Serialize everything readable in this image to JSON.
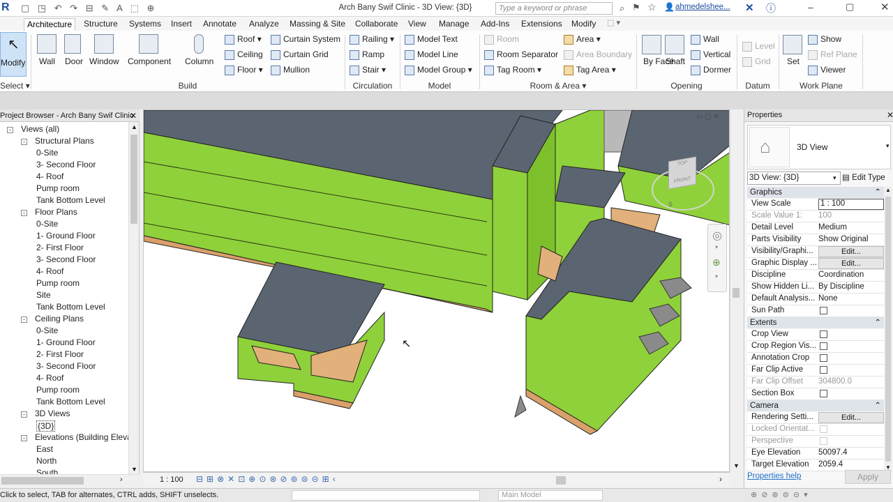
{
  "window": {
    "title": "Arch Bany Swif Clinic - 3D View: {3D}",
    "search_placeholder": "Type a keyword or phrase",
    "user": "ahmedelshee..."
  },
  "tabs": [
    "Architecture",
    "Structure",
    "Systems",
    "Insert",
    "Annotate",
    "Analyze",
    "Massing & Site",
    "Collaborate",
    "View",
    "Manage",
    "Add-Ins",
    "Extensions",
    "Modify"
  ],
  "ribbon": {
    "select": {
      "modify": "Modify",
      "select_label": "Select"
    },
    "build": {
      "label": "Build",
      "wall": "Wall",
      "door": "Door",
      "window": "Window",
      "component": "Component",
      "column": "Column",
      "roof": "Roof",
      "ceiling": "Ceiling",
      "floor": "Floor",
      "curtain_system": "Curtain System",
      "curtain_grid": "Curtain Grid",
      "mullion": "Mullion"
    },
    "circulation": {
      "label": "Circulation",
      "railing": "Railing",
      "ramp": "Ramp",
      "stair": "Stair"
    },
    "model": {
      "label": "Model",
      "model_text": "Model Text",
      "model_line": "Model Line",
      "model_group": "Model Group"
    },
    "room_area": {
      "label": "Room & Area",
      "room": "Room",
      "room_separator": "Room Separator",
      "tag_room": "Tag Room",
      "area": "Area",
      "area_boundary": "Area Boundary",
      "tag_area": "Tag Area"
    },
    "opening": {
      "label": "Opening",
      "by_face": "By Face",
      "shaft": "Shaft",
      "wall": "Wall",
      "vertical": "Vertical",
      "dormer": "Dormer"
    },
    "datum": {
      "label": "Datum",
      "level": "Level",
      "grid": "Grid"
    },
    "work_plane": {
      "label": "Work Plane",
      "set": "Set",
      "show": "Show",
      "ref_plane": "Ref Plane",
      "viewer": "Viewer"
    }
  },
  "project_browser": {
    "title": "Project Browser - Arch Bany Swif Clinic",
    "rows": [
      {
        "label": "Views (all)",
        "level": 0,
        "toggle": "-"
      },
      {
        "label": "Structural Plans",
        "level": 1,
        "toggle": "-"
      },
      {
        "label": "0-Site",
        "level": 2
      },
      {
        "label": "3- Second Floor",
        "level": 2
      },
      {
        "label": "4- Roof",
        "level": 2
      },
      {
        "label": "Pump room",
        "level": 2
      },
      {
        "label": "Tank Bottom Level",
        "level": 2
      },
      {
        "label": "Floor Plans",
        "level": 1,
        "toggle": "-"
      },
      {
        "label": "0-Site",
        "level": 2
      },
      {
        "label": "1- Ground Floor",
        "level": 2
      },
      {
        "label": "2- First Floor",
        "level": 2
      },
      {
        "label": "3- Second Floor",
        "level": 2
      },
      {
        "label": "4- Roof",
        "level": 2
      },
      {
        "label": "Pump room",
        "level": 2
      },
      {
        "label": "Site",
        "level": 2
      },
      {
        "label": "Tank Bottom Level",
        "level": 2
      },
      {
        "label": "Ceiling Plans",
        "level": 1,
        "toggle": "-"
      },
      {
        "label": "0-Site",
        "level": 2
      },
      {
        "label": "1- Ground Floor",
        "level": 2
      },
      {
        "label": "2- First Floor",
        "level": 2
      },
      {
        "label": "3- Second Floor",
        "level": 2
      },
      {
        "label": "4- Roof",
        "level": 2
      },
      {
        "label": "Pump room",
        "level": 2
      },
      {
        "label": "Tank Bottom Level",
        "level": 2
      },
      {
        "label": "3D Views",
        "level": 1,
        "toggle": "-"
      },
      {
        "label": "{3D}",
        "level": 2,
        "selected": true
      },
      {
        "label": "Elevations (Building Elevation",
        "level": 1,
        "toggle": "-"
      },
      {
        "label": "East",
        "level": 2
      },
      {
        "label": "North",
        "level": 2
      },
      {
        "label": "South",
        "level": 2
      }
    ]
  },
  "viewcube": {
    "top": "TOP",
    "front": "FRONT",
    "compass": "S"
  },
  "view_bar": {
    "scale": "1 : 100"
  },
  "properties": {
    "title": "Properties",
    "type_name": "3D View",
    "selector": "3D View: {3D}",
    "edit_type": "Edit Type",
    "sections": {
      "graphics": "Graphics",
      "extents": "Extents",
      "camera": "Camera"
    },
    "graphics_rows": [
      {
        "k": "View Scale",
        "v": "1 : 100",
        "input": true
      },
      {
        "k": "Scale Value    1:",
        "v": "100",
        "disabled": true
      },
      {
        "k": "Detail Level",
        "v": "Medium"
      },
      {
        "k": "Parts Visibility",
        "v": "Show Original"
      },
      {
        "k": "Visibility/Graphi...",
        "v": "Edit...",
        "button": true
      },
      {
        "k": "Graphic Display ...",
        "v": "Edit...",
        "button": true
      },
      {
        "k": "Discipline",
        "v": "Coordination"
      },
      {
        "k": "Show Hidden Li...",
        "v": "By Discipline"
      },
      {
        "k": "Default Analysis...",
        "v": "None"
      },
      {
        "k": "Sun Path",
        "v": "",
        "check": true
      }
    ],
    "extents_rows": [
      {
        "k": "Crop View",
        "v": "",
        "check": true
      },
      {
        "k": "Crop Region Vis...",
        "v": "",
        "check": true
      },
      {
        "k": "Annotation Crop",
        "v": "",
        "check": true
      },
      {
        "k": "Far Clip Active",
        "v": "",
        "check": true
      },
      {
        "k": "Far Clip Offset",
        "v": "304800.0",
        "disabled": true
      },
      {
        "k": "Section Box",
        "v": "",
        "check": true
      }
    ],
    "camera_rows": [
      {
        "k": "Rendering Setti...",
        "v": "Edit...",
        "button": true
      },
      {
        "k": "Locked Orientat...",
        "v": "",
        "check": true,
        "disabled": true
      },
      {
        "k": "Perspective",
        "v": "",
        "check": true,
        "disabled": true
      },
      {
        "k": "Eye Elevation",
        "v": "50097.4"
      },
      {
        "k": "Target Elevation",
        "v": "2059.4"
      }
    ],
    "help": "Properties help",
    "apply": "Apply"
  },
  "status": {
    "text": "Click to select, TAB for alternates, CTRL adds, SHIFT unselects.",
    "model": "Main Model"
  },
  "colors": {
    "wall_green": "#8fd13a",
    "roof_gray": "#5a6470",
    "floor_tan": "#e2b07a",
    "accent_blue": "#1e6fc8"
  }
}
